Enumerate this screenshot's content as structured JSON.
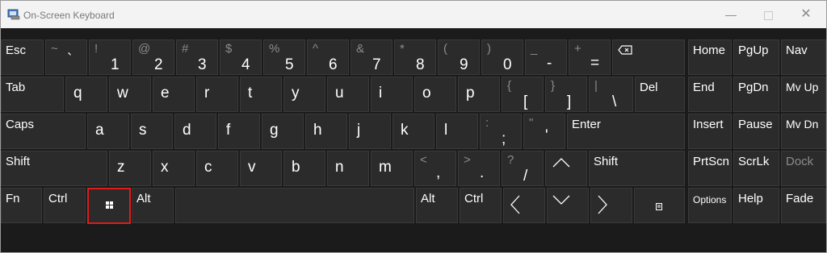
{
  "window": {
    "title": "On-Screen Keyboard",
    "minimize_icon": "minimize-icon",
    "maximize_icon": "maximize-icon",
    "close_icon": "close-icon"
  },
  "keys": {
    "esc": "Esc",
    "tilde": {
      "top": "~",
      "bottom": "`"
    },
    "k1": {
      "top": "!",
      "bottom": "1"
    },
    "k2": {
      "top": "@",
      "bottom": "2"
    },
    "k3": {
      "top": "#",
      "bottom": "3"
    },
    "k4": {
      "top": "$",
      "bottom": "4"
    },
    "k5": {
      "top": "%",
      "bottom": "5"
    },
    "k6": {
      "top": "^",
      "bottom": "6"
    },
    "k7": {
      "top": "&",
      "bottom": "7"
    },
    "k8": {
      "top": "*",
      "bottom": "8"
    },
    "k9": {
      "top": "(",
      "bottom": "9"
    },
    "k0": {
      "top": ")",
      "bottom": "0"
    },
    "minus": {
      "top": "_",
      "bottom": "-"
    },
    "equals": {
      "top": "+",
      "bottom": "="
    },
    "tab": "Tab",
    "q": "q",
    "w": "w",
    "e": "e",
    "r": "r",
    "t": "t",
    "y": "y",
    "u": "u",
    "i": "i",
    "o": "o",
    "p": "p",
    "lbracket": {
      "top": "{",
      "bottom": "["
    },
    "rbracket": {
      "top": "}",
      "bottom": "]"
    },
    "backslash": {
      "top": "|",
      "bottom": "\\"
    },
    "del": "Del",
    "caps": "Caps",
    "a": "a",
    "s": "s",
    "d": "d",
    "f": "f",
    "g": "g",
    "h": "h",
    "j": "j",
    "k": "k",
    "l": "l",
    "semicolon": {
      "top": ":",
      "bottom": ";"
    },
    "quote": {
      "top": "\"",
      "bottom": "'"
    },
    "enter": "Enter",
    "shift_left": "Shift",
    "z": "z",
    "x": "x",
    "c": "c",
    "v": "v",
    "b": "b",
    "n": "n",
    "m": "m",
    "comma": {
      "top": "<",
      "bottom": ","
    },
    "period": {
      "top": ">",
      "bottom": "."
    },
    "slash": {
      "top": "?",
      "bottom": "/"
    },
    "shift_right": "Shift",
    "fn": "Fn",
    "ctrl_left": "Ctrl",
    "alt_left": "Alt",
    "alt_right": "Alt",
    "ctrl_right": "Ctrl",
    "home": "Home",
    "pgup": "PgUp",
    "nav": "Nav",
    "end": "End",
    "pgdn": "PgDn",
    "mvup": "Mv Up",
    "insert": "Insert",
    "pause": "Pause",
    "mvdn": "Mv Dn",
    "prtscn": "PrtScn",
    "scrlk": "ScrLk",
    "dock": "Dock",
    "options": "Options",
    "help": "Help",
    "fade": "Fade"
  },
  "colors": {
    "key_bg": "#2b2b2b",
    "key_border": "#3a3a3a",
    "shift_symbol": "#8b8b8b",
    "highlight": "#e01b1b"
  }
}
